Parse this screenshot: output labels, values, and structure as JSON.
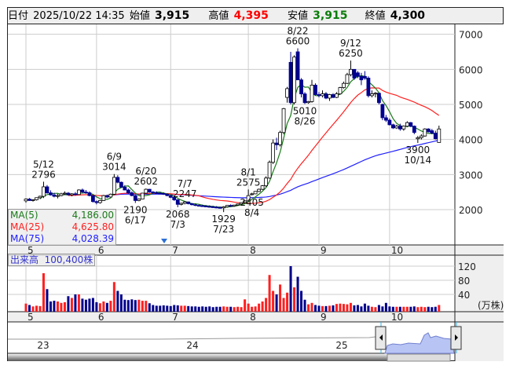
{
  "header": {
    "date_label": "日付",
    "datetime": "2025/10/22 14:35",
    "open_label": "始値",
    "open": "3,915",
    "high_label": "高値",
    "high": "4,395",
    "low_label": "安値",
    "low": "3,915",
    "close_label": "終値",
    "close": "4,300"
  },
  "colors": {
    "up_volume": "#ff2020",
    "down_volume": "#00008b",
    "down_candle": "#000090",
    "ma5": "#1a7a1a",
    "ma25": "#ff2020",
    "ma75": "#2020ff",
    "high": "#ff0000",
    "low": "#0a7d0a"
  },
  "ma_legend": [
    {
      "label": "MA(5)",
      "value": "4,186.00"
    },
    {
      "label": "MA(25)",
      "value": "4,625.80"
    },
    {
      "label": "MA(75)",
      "value": "4,028.39"
    }
  ],
  "volume_legend": {
    "label": "出来高",
    "value": "100,400株"
  },
  "chart_data": {
    "type": "candlestick",
    "price_axis": {
      "ticks": [
        "2000",
        "3000",
        "4000",
        "5000",
        "6000",
        "7000"
      ],
      "range": [
        1500,
        7300
      ]
    },
    "volume_axis": {
      "ticks": [
        "40",
        "80",
        "120"
      ],
      "unit": "(万株)",
      "range": [
        0,
        135
      ]
    },
    "months": [
      {
        "label": "5",
        "idx": 0
      },
      {
        "label": "6",
        "idx": 20
      },
      {
        "label": "7",
        "idx": 41
      },
      {
        "label": "8",
        "idx": 63
      },
      {
        "label": "9",
        "idx": 83
      },
      {
        "label": "10",
        "idx": 103
      }
    ],
    "ohlcv": [
      [
        2250,
        2320,
        2200,
        2300,
        14
      ],
      [
        2300,
        2330,
        2250,
        2260,
        10
      ],
      [
        2260,
        2300,
        2230,
        2280,
        6
      ],
      [
        2280,
        2350,
        2260,
        2340,
        8
      ],
      [
        2340,
        2400,
        2300,
        2380,
        7
      ],
      [
        2380,
        2796,
        2330,
        2650,
        100
      ],
      [
        2650,
        2700,
        2450,
        2480,
        55
      ],
      [
        2480,
        2550,
        2400,
        2420,
        20
      ],
      [
        2420,
        2480,
        2350,
        2380,
        22
      ],
      [
        2380,
        2450,
        2320,
        2400,
        20
      ],
      [
        2400,
        2480,
        2380,
        2450,
        16
      ],
      [
        2450,
        2520,
        2420,
        2470,
        18
      ],
      [
        2470,
        2500,
        2400,
        2420,
        35
      ],
      [
        2420,
        2470,
        2380,
        2450,
        30
      ],
      [
        2450,
        2500,
        2400,
        2430,
        40
      ],
      [
        2430,
        2580,
        2420,
        2560,
        40
      ],
      [
        2560,
        2600,
        2480,
        2500,
        28
      ],
      [
        2500,
        2560,
        2450,
        2480,
        25
      ],
      [
        2480,
        2520,
        2380,
        2400,
        28
      ],
      [
        2400,
        2420,
        2200,
        2230,
        30
      ],
      [
        2230,
        2260,
        2150,
        2200,
        18
      ],
      [
        2200,
        2280,
        2170,
        2260,
        15
      ],
      [
        2260,
        2420,
        2250,
        2400,
        20
      ],
      [
        2400,
        2430,
        2330,
        2360,
        16
      ],
      [
        2360,
        2460,
        2340,
        2440,
        22
      ],
      [
        2440,
        3014,
        2420,
        2920,
        75
      ],
      [
        2920,
        2980,
        2750,
        2780,
        50
      ],
      [
        2780,
        2800,
        2620,
        2640,
        40
      ],
      [
        2640,
        2700,
        2550,
        2560,
        25
      ],
      [
        2560,
        2600,
        2450,
        2480,
        24
      ],
      [
        2480,
        2520,
        2380,
        2400,
        26
      ],
      [
        2400,
        2420,
        2190,
        2260,
        24
      ],
      [
        2260,
        2320,
        2240,
        2300,
        25
      ],
      [
        2300,
        2480,
        2290,
        2470,
        22
      ],
      [
        2470,
        2602,
        2450,
        2580,
        22
      ],
      [
        2580,
        2590,
        2480,
        2500,
        15
      ],
      [
        2500,
        2530,
        2460,
        2480,
        10
      ],
      [
        2480,
        2520,
        2450,
        2470,
        8
      ],
      [
        2470,
        2500,
        2440,
        2460,
        8
      ],
      [
        2460,
        2490,
        2420,
        2440,
        9
      ],
      [
        2440,
        2460,
        2380,
        2400,
        8
      ],
      [
        2400,
        2420,
        2330,
        2350,
        7
      ],
      [
        2350,
        2370,
        2250,
        2280,
        10
      ],
      [
        2280,
        2300,
        2068,
        2150,
        9
      ],
      [
        2150,
        2200,
        2120,
        2180,
        8
      ],
      [
        2180,
        2247,
        2150,
        2220,
        8
      ],
      [
        2220,
        2230,
        2150,
        2170,
        7
      ],
      [
        2170,
        2190,
        2120,
        2140,
        6
      ],
      [
        2140,
        2170,
        2100,
        2120,
        6
      ],
      [
        2120,
        2150,
        2090,
        2110,
        5
      ],
      [
        2110,
        2140,
        2080,
        2100,
        6
      ],
      [
        2100,
        2130,
        2070,
        2090,
        5
      ],
      [
        2090,
        2120,
        2060,
        2080,
        6
      ],
      [
        2080,
        2110,
        2050,
        2070,
        4
      ],
      [
        2070,
        2100,
        2040,
        2060,
        5
      ],
      [
        2060,
        2090,
        2030,
        2050,
        5
      ],
      [
        2050,
        2100,
        1929,
        2080,
        6
      ],
      [
        2080,
        2130,
        2060,
        2120,
        5
      ],
      [
        2120,
        2150,
        2080,
        2100,
        5
      ],
      [
        2100,
        2140,
        2080,
        2130,
        4
      ],
      [
        2130,
        2170,
        2110,
        2160,
        5
      ],
      [
        2160,
        2210,
        2140,
        2200,
        4
      ],
      [
        2200,
        2260,
        2180,
        2250,
        26
      ],
      [
        2250,
        2575,
        2240,
        2400,
        14
      ],
      [
        2430,
        2480,
        2405,
        2450,
        5
      ],
      [
        2450,
        2530,
        2440,
        2520,
        6
      ],
      [
        2520,
        2600,
        2500,
        2580,
        14
      ],
      [
        2580,
        2700,
        2560,
        2680,
        20
      ],
      [
        2680,
        2950,
        2650,
        2900,
        30
      ],
      [
        2900,
        3400,
        2880,
        3350,
        95
      ],
      [
        3350,
        4000,
        3300,
        3900,
        50
      ],
      [
        3900,
        4050,
        3700,
        3850,
        40
      ],
      [
        3850,
        4250,
        3800,
        4200,
        68
      ],
      [
        4200,
        4900,
        4150,
        4880,
        30
      ],
      [
        5200,
        5500,
        5050,
        5450,
        45
      ],
      [
        6200,
        6500,
        5000,
        5050,
        120
      ],
      [
        5050,
        6400,
        5000,
        6350,
        60
      ],
      [
        6500,
        6600,
        5700,
        5700,
        90
      ],
      [
        5700,
        5750,
        5200,
        5300,
        50
      ],
      [
        5300,
        5350,
        5010,
        5050,
        25
      ],
      [
        5050,
        5100,
        5020,
        5080,
        12
      ],
      [
        5080,
        5700,
        5050,
        5550,
        16
      ],
      [
        5550,
        5600,
        5250,
        5280,
        10
      ],
      [
        5280,
        5350,
        5200,
        5250,
        8
      ],
      [
        5250,
        5400,
        5200,
        5300,
        7
      ],
      [
        5300,
        5350,
        5150,
        5180,
        7
      ],
      [
        5180,
        5300,
        5100,
        5280,
        8
      ],
      [
        5280,
        5320,
        5180,
        5200,
        9
      ],
      [
        5200,
        5350,
        5180,
        5300,
        13
      ],
      [
        5300,
        5500,
        5280,
        5480,
        14
      ],
      [
        5480,
        5650,
        5450,
        5600,
        13
      ],
      [
        5600,
        5900,
        5580,
        5850,
        12
      ],
      [
        5850,
        6250,
        5800,
        6000,
        16
      ],
      [
        6000,
        6000,
        5700,
        5750,
        9
      ],
      [
        5900,
        5950,
        5750,
        5800,
        10
      ],
      [
        5800,
        5900,
        5550,
        5700,
        6
      ],
      [
        5800,
        5950,
        5700,
        5750,
        14
      ],
      [
        5750,
        5800,
        5200,
        5250,
        8
      ],
      [
        5250,
        5400,
        5200,
        5300,
        5
      ],
      [
        5300,
        5350,
        5200,
        5320,
        4
      ],
      [
        5320,
        5330,
        5000,
        5050,
        10
      ],
      [
        5000,
        5020,
        4550,
        4620,
        6
      ],
      [
        4620,
        4700,
        4500,
        4550,
        16
      ],
      [
        4550,
        4600,
        4400,
        4420,
        6
      ],
      [
        4420,
        4450,
        4300,
        4330,
        5
      ],
      [
        4330,
        4420,
        4300,
        4380,
        5
      ],
      [
        4380,
        4450,
        4250,
        4300,
        5
      ],
      [
        4300,
        4400,
        4250,
        4380,
        5
      ],
      [
        4380,
        4520,
        4350,
        4480,
        5
      ],
      [
        4480,
        4500,
        4350,
        4380,
        5
      ],
      [
        4380,
        4400,
        4150,
        4200,
        6
      ],
      [
        4020,
        4100,
        3900,
        4050,
        4
      ],
      [
        4050,
        4150,
        4000,
        4100,
        5
      ],
      [
        4100,
        4320,
        4080,
        4300,
        4
      ],
      [
        4300,
        4320,
        4200,
        4220,
        5
      ],
      [
        4250,
        4300,
        4150,
        4180,
        4
      ],
      [
        4180,
        4250,
        4000,
        4020,
        5
      ],
      [
        3915,
        4395,
        3915,
        4300,
        10.04
      ]
    ],
    "annotations": [
      {
        "date": "5/12",
        "value": "2796",
        "idx": 5,
        "pos": "above"
      },
      {
        "date": "6/9",
        "value": "3014",
        "idx": 25,
        "pos": "above"
      },
      {
        "date": "6/17",
        "value": "2190",
        "idx": 31,
        "pos": "below"
      },
      {
        "date": "6/20",
        "value": "2602",
        "idx": 34,
        "pos": "above"
      },
      {
        "date": "7/3",
        "value": "2068",
        "idx": 43,
        "pos": "below"
      },
      {
        "date": "7/7",
        "value": "2247",
        "idx": 45,
        "pos": "above"
      },
      {
        "date": "7/23",
        "value": "1929",
        "idx": 56,
        "pos": "below"
      },
      {
        "date": "8/1",
        "value": "2575",
        "idx": 63,
        "pos": "above"
      },
      {
        "date": "8/4",
        "value": "2405",
        "idx": 64,
        "pos": "below"
      },
      {
        "date": "8/22",
        "value": "6600",
        "idx": 77,
        "pos": "above"
      },
      {
        "date": "8/26",
        "value": "5010",
        "idx": 79,
        "pos": "below"
      },
      {
        "date": "9/12",
        "value": "6250",
        "idx": 92,
        "pos": "above"
      },
      {
        "date": "10/14",
        "value": "3900",
        "idx": 111,
        "pos": "below"
      }
    ],
    "navigator": {
      "year_labels": [
        "23",
        "24",
        "25"
      ]
    }
  }
}
